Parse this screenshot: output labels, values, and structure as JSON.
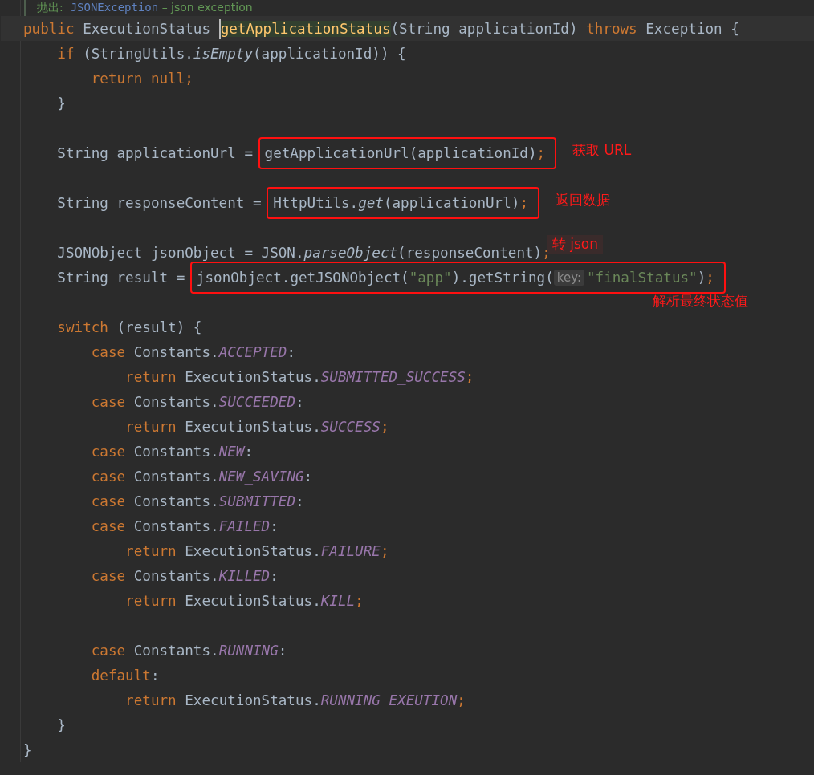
{
  "editor": {
    "lines": [
      {
        "kind": "doc",
        "tokens": [
          {
            "kind": "doctag",
            "t": "抛出:  "
          },
          {
            "kind": "doclink",
            "t": "JSONException"
          },
          {
            "kind": "doc",
            "t": " – json exception"
          }
        ]
      },
      {
        "kind": "code",
        "current": true,
        "tokens": [
          {
            "kind": "kw",
            "t": "public "
          },
          {
            "kind": "id",
            "t": "ExecutionStatus "
          },
          {
            "kind": "caret"
          },
          {
            "kind": "decl",
            "t": "getApplicationStatus"
          },
          {
            "kind": "id",
            "t": "(String applicationId) "
          },
          {
            "kind": "kw",
            "t": "throws "
          },
          {
            "kind": "id",
            "t": "Exception {"
          }
        ]
      },
      {
        "kind": "code",
        "tokens": [
          {
            "kind": "kw",
            "t": "    if "
          },
          {
            "kind": "id",
            "t": "(StringUtils."
          },
          {
            "kind": "static",
            "t": "isEmpty"
          },
          {
            "kind": "id",
            "t": "(applicationId)) {"
          }
        ]
      },
      {
        "kind": "code",
        "tokens": [
          {
            "kind": "kw",
            "t": "        return null;"
          }
        ]
      },
      {
        "kind": "code",
        "tokens": [
          {
            "kind": "id",
            "t": "    }"
          }
        ]
      },
      {
        "kind": "blank"
      },
      {
        "kind": "code",
        "tokens": [
          {
            "kind": "id",
            "t": "    String applicationUrl = "
          }
        ],
        "box": [
          {
            "kind": "id",
            "t": "getApplicationUrl(applicationId)"
          },
          {
            "kind": "kw",
            "t": ";"
          }
        ],
        "note": {
          "kind": "beside",
          "text": "获取 URL"
        }
      },
      {
        "kind": "blank"
      },
      {
        "kind": "code",
        "tokens": [
          {
            "kind": "id",
            "t": "    String responseContent = "
          }
        ],
        "box": [
          {
            "kind": "id",
            "t": "HttpUtils."
          },
          {
            "kind": "static",
            "t": "get"
          },
          {
            "kind": "id",
            "t": "(applicationUrl)"
          },
          {
            "kind": "kw",
            "t": ";"
          }
        ],
        "note": {
          "kind": "beside",
          "text": "返回数据"
        }
      },
      {
        "kind": "blank"
      },
      {
        "kind": "code",
        "tokens": [
          {
            "kind": "id",
            "t": "    JSONObject jsonObject = JSON."
          },
          {
            "kind": "static",
            "t": "parseObject"
          },
          {
            "kind": "id",
            "t": "(responseContent)"
          },
          {
            "kind": "kw",
            "t": ";"
          }
        ],
        "note": {
          "kind": "raised",
          "text": "转 json"
        }
      },
      {
        "kind": "code",
        "tokens": [
          {
            "kind": "id",
            "t": "    String result = "
          }
        ],
        "box": [
          {
            "kind": "id",
            "t": "jsonObject.getJSONObject("
          },
          {
            "kind": "str",
            "t": "\"app\""
          },
          {
            "kind": "id",
            "t": ").getString("
          },
          {
            "kind": "hint",
            "t": "key:"
          },
          {
            "kind": "str",
            "t": "\"finalStatus\""
          },
          {
            "kind": "id",
            "t": ")"
          },
          {
            "kind": "kw",
            "t": ";"
          }
        ],
        "note": {
          "kind": "below",
          "text": "解析最终状态值"
        }
      },
      {
        "kind": "blank"
      },
      {
        "kind": "code",
        "tokens": [
          {
            "kind": "kw",
            "t": "    switch "
          },
          {
            "kind": "id",
            "t": "(result) {"
          }
        ]
      },
      {
        "kind": "code",
        "tokens": [
          {
            "kind": "kw",
            "t": "        case "
          },
          {
            "kind": "id",
            "t": "Constants."
          },
          {
            "kind": "const",
            "t": "ACCEPTED"
          },
          {
            "kind": "id",
            "t": ":"
          }
        ]
      },
      {
        "kind": "code",
        "tokens": [
          {
            "kind": "kw",
            "t": "            return "
          },
          {
            "kind": "id",
            "t": "ExecutionStatus."
          },
          {
            "kind": "const",
            "t": "SUBMITTED_SUCCESS"
          },
          {
            "kind": "kw",
            "t": ";"
          }
        ]
      },
      {
        "kind": "code",
        "tokens": [
          {
            "kind": "kw",
            "t": "        case "
          },
          {
            "kind": "id",
            "t": "Constants."
          },
          {
            "kind": "const",
            "t": "SUCCEEDED"
          },
          {
            "kind": "id",
            "t": ":"
          }
        ]
      },
      {
        "kind": "code",
        "tokens": [
          {
            "kind": "kw",
            "t": "            return "
          },
          {
            "kind": "id",
            "t": "ExecutionStatus."
          },
          {
            "kind": "const",
            "t": "SUCCESS"
          },
          {
            "kind": "kw",
            "t": ";"
          }
        ]
      },
      {
        "kind": "code",
        "tokens": [
          {
            "kind": "kw",
            "t": "        case "
          },
          {
            "kind": "id",
            "t": "Constants."
          },
          {
            "kind": "const",
            "t": "NEW"
          },
          {
            "kind": "id",
            "t": ":"
          }
        ]
      },
      {
        "kind": "code",
        "tokens": [
          {
            "kind": "kw",
            "t": "        case "
          },
          {
            "kind": "id",
            "t": "Constants."
          },
          {
            "kind": "const",
            "t": "NEW_SAVING"
          },
          {
            "kind": "id",
            "t": ":"
          }
        ]
      },
      {
        "kind": "code",
        "tokens": [
          {
            "kind": "kw",
            "t": "        case "
          },
          {
            "kind": "id",
            "t": "Constants."
          },
          {
            "kind": "const",
            "t": "SUBMITTED"
          },
          {
            "kind": "id",
            "t": ":"
          }
        ]
      },
      {
        "kind": "code",
        "tokens": [
          {
            "kind": "kw",
            "t": "        case "
          },
          {
            "kind": "id",
            "t": "Constants."
          },
          {
            "kind": "const",
            "t": "FAILED"
          },
          {
            "kind": "id",
            "t": ":"
          }
        ]
      },
      {
        "kind": "code",
        "tokens": [
          {
            "kind": "kw",
            "t": "            return "
          },
          {
            "kind": "id",
            "t": "ExecutionStatus."
          },
          {
            "kind": "const",
            "t": "FAILURE"
          },
          {
            "kind": "kw",
            "t": ";"
          }
        ]
      },
      {
        "kind": "code",
        "tokens": [
          {
            "kind": "kw",
            "t": "        case "
          },
          {
            "kind": "id",
            "t": "Constants."
          },
          {
            "kind": "const",
            "t": "KILLED"
          },
          {
            "kind": "id",
            "t": ":"
          }
        ]
      },
      {
        "kind": "code",
        "tokens": [
          {
            "kind": "kw",
            "t": "            return "
          },
          {
            "kind": "id",
            "t": "ExecutionStatus."
          },
          {
            "kind": "const",
            "t": "KILL"
          },
          {
            "kind": "kw",
            "t": ";"
          }
        ]
      },
      {
        "kind": "blank"
      },
      {
        "kind": "code",
        "tokens": [
          {
            "kind": "kw",
            "t": "        case "
          },
          {
            "kind": "id",
            "t": "Constants."
          },
          {
            "kind": "const",
            "t": "RUNNING"
          },
          {
            "kind": "id",
            "t": ":"
          }
        ]
      },
      {
        "kind": "code",
        "tokens": [
          {
            "kind": "kw",
            "t": "        default"
          },
          {
            "kind": "id",
            "t": ":"
          }
        ]
      },
      {
        "kind": "code",
        "tokens": [
          {
            "kind": "kw",
            "t": "            return "
          },
          {
            "kind": "id",
            "t": "ExecutionStatus."
          },
          {
            "kind": "const",
            "t": "RUNNING_EXEUTION"
          },
          {
            "kind": "kw",
            "t": ";"
          }
        ]
      },
      {
        "kind": "code",
        "tokens": [
          {
            "kind": "id",
            "t": "    }"
          }
        ]
      },
      {
        "kind": "code",
        "tokens": [
          {
            "kind": "id",
            "t": "}"
          }
        ]
      }
    ]
  }
}
